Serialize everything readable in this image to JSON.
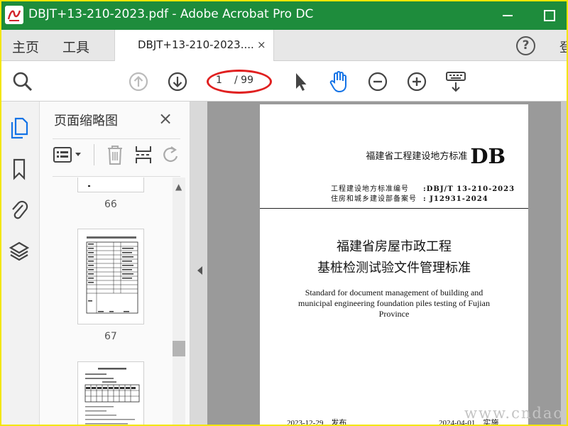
{
  "window": {
    "title": "DBJT+13-210-2023.pdf - Adobe Acrobat Pro DC"
  },
  "tabs": {
    "home": "主页",
    "tools": "工具",
    "document": "DBJT+13-210-2023....",
    "close": "×",
    "sign_in": "登"
  },
  "toolbar": {
    "icons": [
      "search-icon",
      "page-up-icon",
      "page-down-icon",
      "select-arrow-icon",
      "hand-icon",
      "zoom-out-icon",
      "zoom-in-icon",
      "keyboard-icon"
    ],
    "page_current": "1",
    "page_total": "/ 99"
  },
  "sidebar": {
    "title": "页面缩略图",
    "close": "×",
    "rail_icons": [
      "page-thumbnails-icon",
      "bookmark-icon",
      "attachment-icon",
      "layers-icon"
    ],
    "thumbnails": [
      {
        "page": "66"
      },
      {
        "page": "67"
      }
    ]
  },
  "document": {
    "header_org": "福建省工程建设地方标准",
    "header_code": "DB",
    "meta": [
      {
        "key": "工程建设地方标准编号",
        "value": ":DBJ/T 13-210-2023"
      },
      {
        "key": "住房和城乡建设部备案号",
        "value": ":  J12931-2024"
      }
    ],
    "title_line1": "福建省房屋市政工程",
    "title_line2": "基桩检测试验文件管理标准",
    "english_title": "Standard for document management of building and municipal engineering foundation piles testing of Fujian Province",
    "issue_date": "2023-12-29",
    "issue_label": "发布",
    "effective_date": "2024-04-01",
    "effective_label": "实施"
  },
  "watermark": "www.cndao",
  "colors": {
    "titlebar": "#1e8c3c",
    "accent_blue": "#1473e6",
    "annotation_red": "#e02020"
  }
}
